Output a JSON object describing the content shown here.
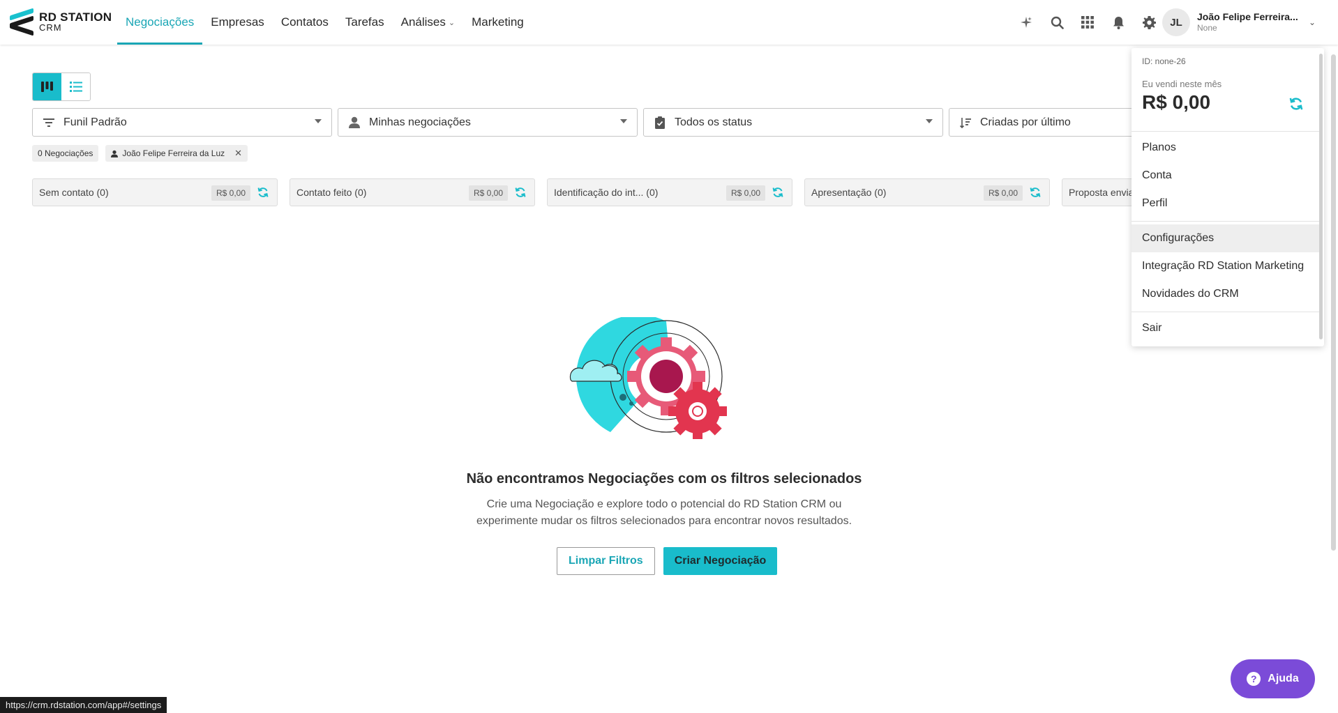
{
  "logo": {
    "line1": "RD STATION",
    "line2": "CRM"
  },
  "nav": {
    "items": [
      {
        "label": "Negociações"
      },
      {
        "label": "Empresas"
      },
      {
        "label": "Contatos"
      },
      {
        "label": "Tarefas"
      },
      {
        "label": "Análises"
      },
      {
        "label": "Marketing"
      }
    ],
    "active_index": 0,
    "icons": [
      "sparkle-icon",
      "search-icon",
      "apps-grid-icon",
      "bell-icon",
      "gear-icon"
    ]
  },
  "user": {
    "initials": "JL",
    "name": "João Felipe Ferreira...",
    "subtitle": "None"
  },
  "filters": {
    "funnel": "Funil Padrão",
    "owner": "Minhas negociações",
    "status": "Todos os status",
    "sort": "Criadas por último"
  },
  "chips": {
    "count": "0 Negociações",
    "person": "João Felipe Ferreira da Luz"
  },
  "stages": [
    {
      "name": "Sem contato (0)",
      "value": "R$ 0,00"
    },
    {
      "name": "Contato feito (0)",
      "value": "R$ 0,00"
    },
    {
      "name": "Identificação do int... (0)",
      "value": "R$ 0,00"
    },
    {
      "name": "Apresentação (0)",
      "value": "R$ 0,00"
    },
    {
      "name": "Proposta envia",
      "value": ""
    }
  ],
  "empty": {
    "title": "Não encontramos Negociações com os filtros selecionados",
    "description": "Crie uma Negociação e explore todo o potencial do RD Station CRM ou experimente mudar os filtros selecionados para encontrar novos resultados.",
    "clear_button": "Limpar Filtros",
    "create_button": "Criar Negociação"
  },
  "dropdown": {
    "id_text": "ID: none-26",
    "sales_label": "Eu vendi neste mês",
    "sales_amount": "R$ 0,00",
    "group1": [
      "Planos",
      "Conta",
      "Perfil"
    ],
    "group2": [
      "Configurações",
      "Integração RD Station Marketing",
      "Novidades do CRM"
    ],
    "group3": [
      "Sair"
    ]
  },
  "help": {
    "label": "Ajuda"
  },
  "status_url": "https://crm.rdstation.com/app#/settings",
  "colors": {
    "accent": "#19bccb",
    "help_purple": "#7b4bd8"
  }
}
